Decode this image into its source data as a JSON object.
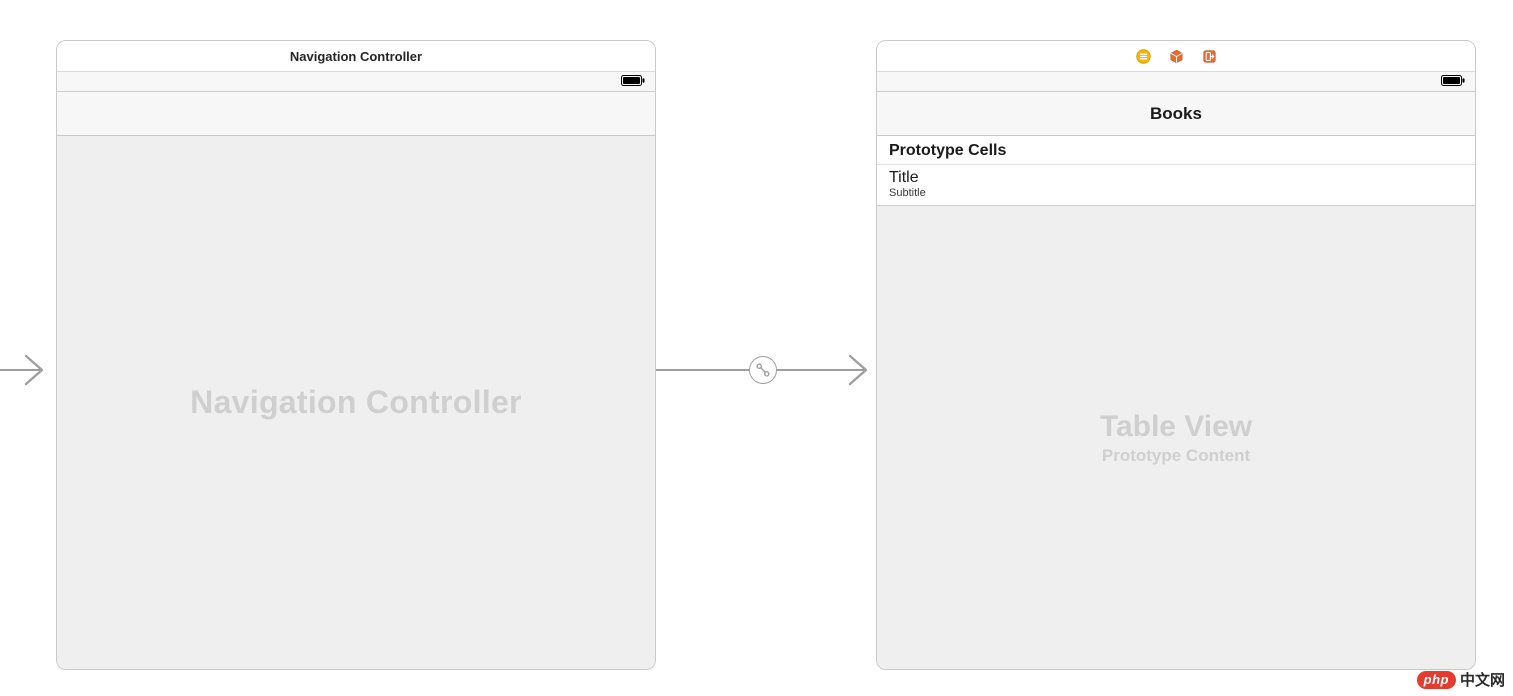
{
  "left_scene": {
    "title": "Navigation Controller",
    "placeholder": "Navigation Controller"
  },
  "right_scene": {
    "icons": {
      "nav_item": "list-icon",
      "first_responder": "cube-icon",
      "exit": "exit-icon"
    },
    "nav_title": "Books",
    "prototype_header": "Prototype Cells",
    "cell": {
      "title": "Title",
      "subtitle": "Subtitle"
    },
    "placeholder_main": "Table View",
    "placeholder_sub": "Prototype Content"
  },
  "watermark": {
    "pill": "php",
    "text": "中文网"
  }
}
